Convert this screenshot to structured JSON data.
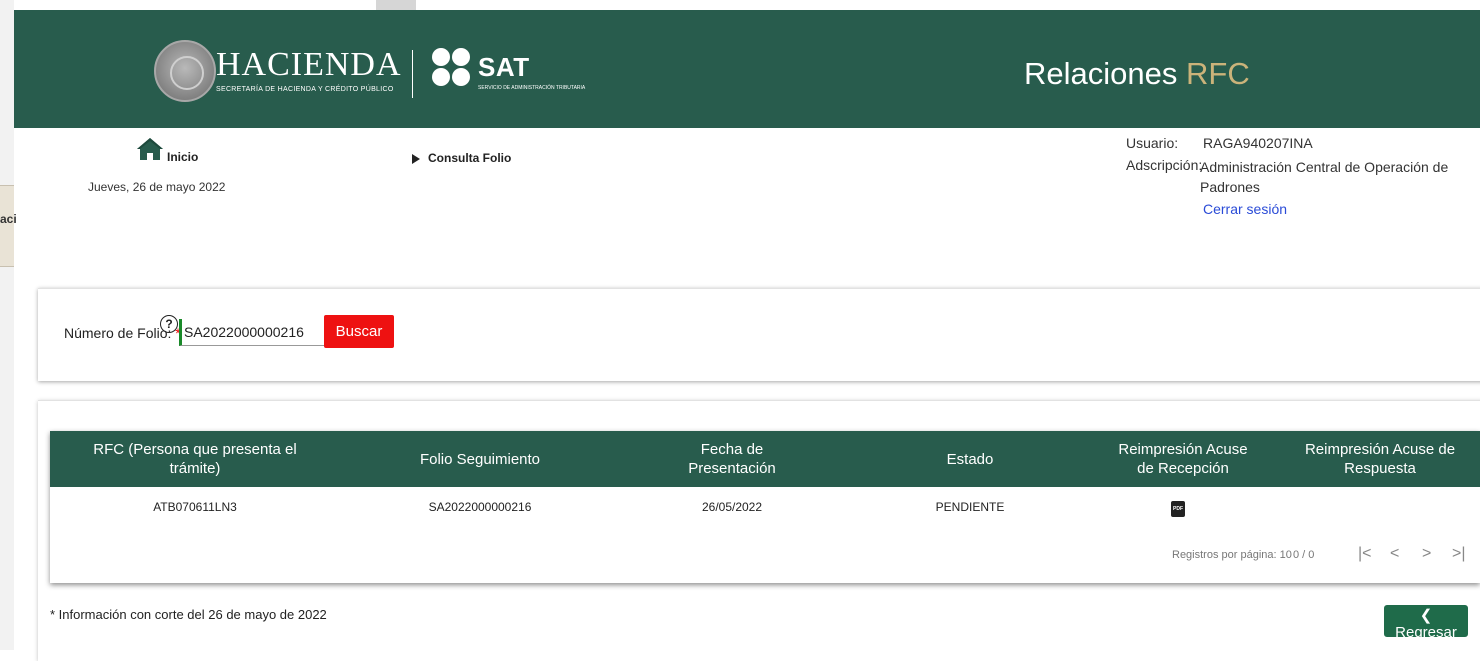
{
  "background": {
    "left_fragment": "aci"
  },
  "header": {
    "brand_name": "HACIENDA",
    "brand_subtitle": "SECRETARÍA DE HACIENDA Y CRÉDITO PÚBLICO",
    "sat_name": "SAT",
    "sat_subtitle": "SERVICIO DE ADMINISTRACIÓN TRIBUTARIA",
    "app_title_main": "Relaciones",
    "app_title_accent": "RFC",
    "colors": {
      "header_bg": "#285c4d",
      "accent": "#cbb37a"
    }
  },
  "nav": {
    "home_label": "Inicio",
    "date": "Jueves, 26 de mayo 2022",
    "current_section": "Consulta Folio",
    "home_icon": "home-icon"
  },
  "user": {
    "user_label": "Usuario:",
    "user_value": "RAGA940207INA",
    "adscripcion_label": "Adscripción:",
    "adscripcion_value": "Administración Central de Operación de Padrones",
    "logout": "Cerrar sesión"
  },
  "search": {
    "label": "Número de Folio:",
    "required_mark": "*",
    "help_icon": "question-circle-icon",
    "value": "SA2022000000216",
    "button": "Buscar",
    "button_color": "#ee1111"
  },
  "results": {
    "columns": [
      "RFC (Persona que presenta el trámite)",
      "Folio Seguimiento",
      "Fecha de Presentación",
      "Estado",
      "Reimpresión Acuse de Recepción",
      "Reimpresión Acuse de Respuesta"
    ],
    "rows": [
      {
        "rfc": "ATB070611LN3",
        "folio": "SA2022000000216",
        "fecha": "26/05/2022",
        "estado": "PENDIENTE",
        "acuse_recepcion_icon": "pdf-icon",
        "pdf_glyph": "PDF",
        "acuse_respuesta": ""
      }
    ],
    "pager": {
      "rows_per_page_label": "Registros por página: 10",
      "count": "0 / 0",
      "first": "|<",
      "prev": "<",
      "next": ">",
      "last": ">|"
    }
  },
  "footer": {
    "note": "* Información con corte del 26 de mayo de 2022",
    "back_button": "Regresar",
    "back_icon": "chevron-left-icon"
  }
}
